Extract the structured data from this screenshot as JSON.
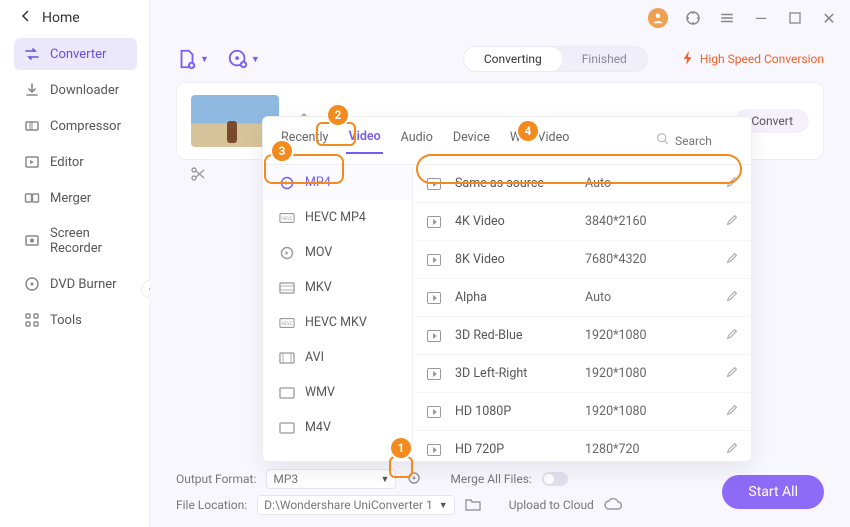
{
  "titlebar": {
    "min": "—",
    "max": "▢",
    "close": "✕"
  },
  "sidebar": {
    "home": "Home",
    "items": [
      {
        "label": "Converter"
      },
      {
        "label": "Downloader"
      },
      {
        "label": "Compressor"
      },
      {
        "label": "Editor"
      },
      {
        "label": "Merger"
      },
      {
        "label": "Screen Recorder"
      },
      {
        "label": "DVD Burner"
      },
      {
        "label": "Tools"
      }
    ]
  },
  "toolbar": {
    "seg": {
      "converting": "Converting",
      "finished": "Finished"
    },
    "hsc": "High Speed Conversion"
  },
  "card": {
    "convert": "Convert"
  },
  "footer": {
    "outLabel": "Output Format:",
    "outValue": "MP3",
    "mergeLabel": "Merge All Files:",
    "locLabel": "File Location:",
    "locValue": "D:\\Wondershare UniConverter 1",
    "uploadLabel": "Upload to Cloud",
    "start": "Start All"
  },
  "panel": {
    "tabs": [
      "Recently",
      "Video",
      "Audio",
      "Device",
      "Web Video"
    ],
    "activeTab": 1,
    "searchPlaceholder": "Search",
    "formats": [
      "MP4",
      "HEVC MP4",
      "MOV",
      "MKV",
      "HEVC MKV",
      "AVI",
      "WMV",
      "M4V"
    ],
    "activeFormat": 0,
    "resolutions": [
      {
        "name": "Same as source",
        "value": "Auto"
      },
      {
        "name": "4K Video",
        "value": "3840*2160"
      },
      {
        "name": "8K Video",
        "value": "7680*4320"
      },
      {
        "name": "Alpha",
        "value": "Auto"
      },
      {
        "name": "3D Red-Blue",
        "value": "1920*1080"
      },
      {
        "name": "3D Left-Right",
        "value": "1920*1080"
      },
      {
        "name": "HD 1080P",
        "value": "1920*1080"
      },
      {
        "name": "HD 720P",
        "value": "1280*720"
      }
    ]
  },
  "callouts": {
    "c1": "1",
    "c2": "2",
    "c3": "3",
    "c4": "4"
  }
}
